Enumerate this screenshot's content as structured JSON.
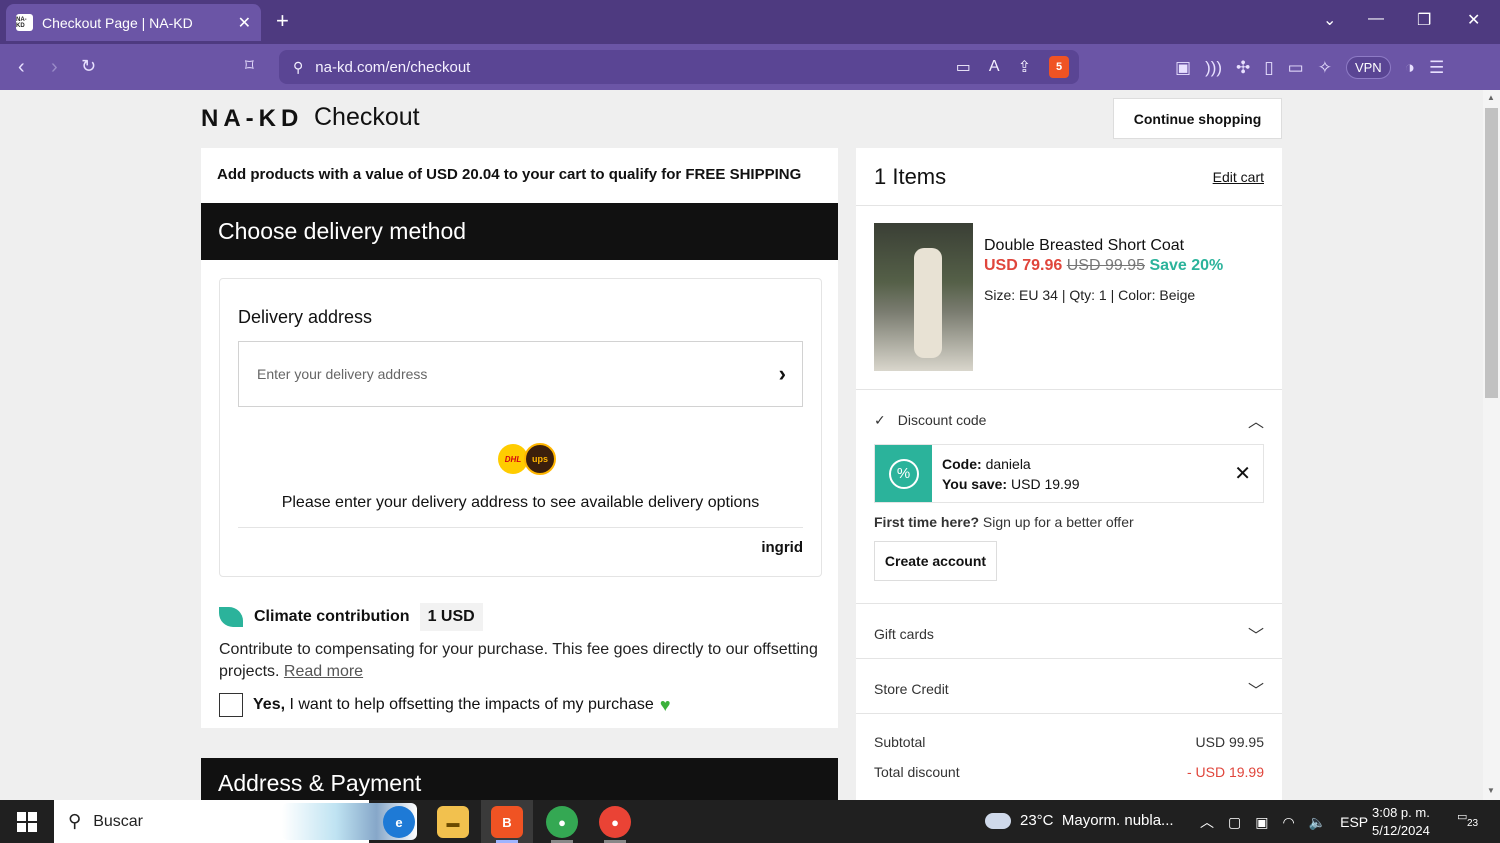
{
  "browser": {
    "tab_title": "Checkout Page | NA-KD",
    "favicon_text": "NA-KD",
    "url": "na-kd.com/en/checkout",
    "shields_count": "5",
    "vpn_label": "VPN"
  },
  "header": {
    "logo": "NA-KD",
    "title": "Checkout",
    "continue_label": "Continue shopping"
  },
  "delivery": {
    "shipping_note": "Add products with a value of USD 20.04 to your cart to qualify for FREE SHIPPING",
    "section_title": "Choose delivery method",
    "address_label": "Delivery address",
    "address_placeholder": "Enter your delivery address",
    "dhl_label": "DHL",
    "ups_label": "ups",
    "hint": "Please enter your delivery address to see available delivery options",
    "provider": "ingrid"
  },
  "climate": {
    "title": "Climate contribution",
    "amount": "1 USD",
    "text": "Contribute to compensating for your purchase. This fee goes directly to our offsetting projects.",
    "read_more": "Read more",
    "check_bold": "Yes,",
    "check_text": " I want to help offsetting the impacts of my purchase"
  },
  "payment": {
    "section_title": "Address & Payment"
  },
  "cart": {
    "items_label": "1 Items",
    "edit_label": "Edit cart",
    "product": {
      "name": "Double Breasted Short Coat",
      "price_now": "USD 79.96",
      "price_old": "USD 99.95",
      "save": "Save 20%",
      "size_label": "Size:",
      "size": "EU 34",
      "qty_label": "Qty:",
      "qty": "1",
      "color_label": "Color:",
      "color": "Beige"
    },
    "discount": {
      "head": "Discount code",
      "code_label": "Code:",
      "code": "daniela",
      "save_label": "You save:",
      "save": "USD 19.99"
    },
    "first_time_bold": "First time here?",
    "first_time_text": " Sign up for a better offer",
    "create_account": "Create account",
    "gift_cards": "Gift cards",
    "store_credit": "Store Credit",
    "summary": {
      "subtotal_label": "Subtotal",
      "subtotal": "USD 99.95",
      "discount_label": "Total discount",
      "discount": "- USD 19.99"
    }
  },
  "taskbar": {
    "search": "Buscar",
    "weather": "23°C  Mayorm. nubla...",
    "lang": "ESP",
    "time": "3:08 p. m.",
    "date": "5/12/2024",
    "notifications": "23"
  }
}
